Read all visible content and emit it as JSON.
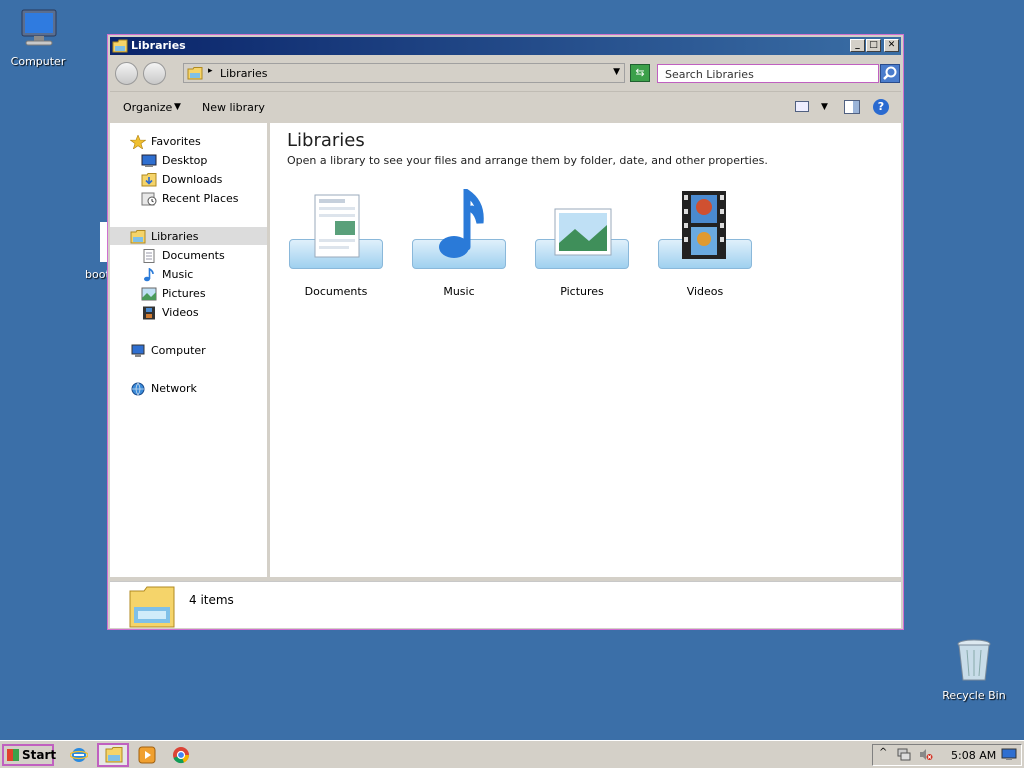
{
  "desktop": {
    "icons": [
      {
        "label": "Computer"
      },
      {
        "label": "Recycle Bin"
      }
    ],
    "partial_label": "boot"
  },
  "window": {
    "title": "Libraries",
    "address": {
      "path": "Libraries"
    },
    "search": {
      "placeholder": "Search Libraries"
    },
    "toolbar": {
      "organize": "Organize",
      "new_library": "New library"
    },
    "navpane": {
      "favorites": "Favorites",
      "favorites_items": [
        "Desktop",
        "Downloads",
        "Recent Places"
      ],
      "libraries": "Libraries",
      "libraries_items": [
        "Documents",
        "Music",
        "Pictures",
        "Videos"
      ],
      "computer": "Computer",
      "network": "Network"
    },
    "content": {
      "title": "Libraries",
      "description": "Open a library to see your files and arrange them by folder, date, and other properties.",
      "libraries": [
        "Documents",
        "Music",
        "Pictures",
        "Videos"
      ]
    },
    "status": {
      "count_text": "4 items"
    }
  },
  "taskbar": {
    "start_label": "Start",
    "clock": "5:08 AM",
    "tray_expand": "^"
  }
}
